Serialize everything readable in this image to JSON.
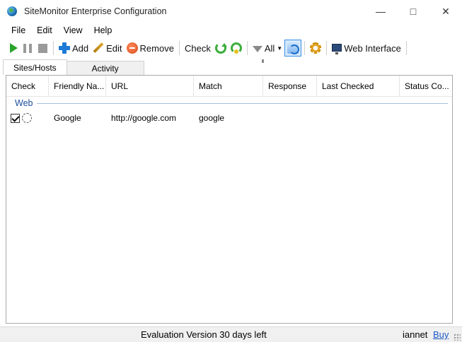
{
  "window": {
    "title": "SiteMonitor Enterprise Configuration",
    "minimize_glyph": "—",
    "maximize_glyph": "□",
    "close_glyph": "✕"
  },
  "menu": {
    "items": [
      "File",
      "Edit",
      "View",
      "Help"
    ]
  },
  "toolbar": {
    "add_label": "Add",
    "edit_label": "Edit",
    "remove_label": "Remove",
    "check_label": "Check",
    "filter_label": "All",
    "web_interface_label": "Web Interface",
    "icons": [
      "play-icon",
      "pause-icon",
      "stop-icon",
      "add-icon",
      "pencil-icon",
      "remove-icon",
      "refresh-icon",
      "refresh-all-icon",
      "filter-icon",
      "sync-icon",
      "gear-icon",
      "monitor-icon"
    ],
    "colors": {
      "play": "#2aa32a",
      "add": "#1c7ad8",
      "refresh": "#3cae3c",
      "active_border": "#3a8ee6"
    }
  },
  "tabs": [
    {
      "label": "Sites/Hosts",
      "active": true
    },
    {
      "label": "Activity",
      "active": false
    }
  ],
  "table": {
    "columns": [
      "Check",
      "Friendly Na...",
      "URL",
      "Match",
      "Response",
      "Last Checked",
      "Status Co..."
    ],
    "groups": [
      {
        "name": "Web",
        "rows": [
          {
            "checked": true,
            "friendly_name": "Google",
            "url": "http://google.com",
            "match": "google",
            "response": "",
            "last_checked": "",
            "status": ""
          }
        ]
      }
    ]
  },
  "statusbar": {
    "message": "Evaluation Version 30 days left",
    "user": "iannet",
    "buy_label": "Buy"
  }
}
